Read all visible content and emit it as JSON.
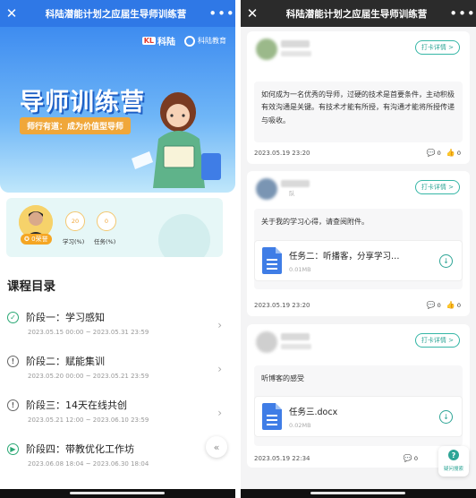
{
  "colors": {
    "accent": "#2ea596",
    "brand_blue": "#2f78e6",
    "orange": "#f0a73a"
  },
  "left": {
    "title": "科陆潜能计划之应届生导师训练营",
    "close_icon": "close-icon",
    "more_icon": "more-icon",
    "hero": {
      "logo_a": "科陆",
      "logo_a_mark": "KL",
      "logo_b": "科陆教育",
      "title": "导师训练营",
      "subtitle": "师行有道：成为价值型导师"
    },
    "stats": {
      "badge": "0荣誉",
      "study_value": "20",
      "study_label": "学习(%)",
      "task_value": "0",
      "task_label": "任务(%)"
    },
    "section_title": "课程目录",
    "stages": [
      {
        "title": "阶段一：学习感知",
        "time": "2023.05.15 00:00 ~ 2023.05.31 23:59",
        "icon": "check-circle-icon"
      },
      {
        "title": "阶段二：赋能集训",
        "time": "2023.05.20 00:00 ~ 2023.05.21 23:59",
        "icon": "alert-circle-icon"
      },
      {
        "title": "阶段三：14天在线共创",
        "time": "2023.05.21 12:00 ~ 2023.06.10 23:59",
        "icon": "alert-circle-icon"
      },
      {
        "title": "阶段四：带教优化工作坊",
        "time": "2023.06.08 18:04 ~ 2023.06.30 18:04",
        "icon": "play-circle-icon"
      }
    ]
  },
  "right": {
    "title": "科陆潜能计划之应届生导师训练营",
    "checkin_label": "打卡详情 >",
    "posts": [
      {
        "text": "如何成为一名优秀的导师，过硬的技术是首要条件，主动积极有效沟通是关键。有技术才能有所授，有沟通才能将所授传递与吸收。",
        "time": "2023.05.19 23:20",
        "comments": "0",
        "likes": "0"
      },
      {
        "sub": "队",
        "text": "关于我的学习心得，请查阅附件。",
        "file_name": "任务二：听播客，分享学习…",
        "file_size": "0.01MB",
        "time": "2023.05.19 23:20",
        "comments": "0",
        "likes": "0"
      },
      {
        "text": "听博客的感受",
        "file_name": "任务三.docx",
        "file_size": "0.02MB",
        "time": "2023.05.19 22:34",
        "comments": "0"
      }
    ],
    "help_label": "疑问搜索"
  }
}
